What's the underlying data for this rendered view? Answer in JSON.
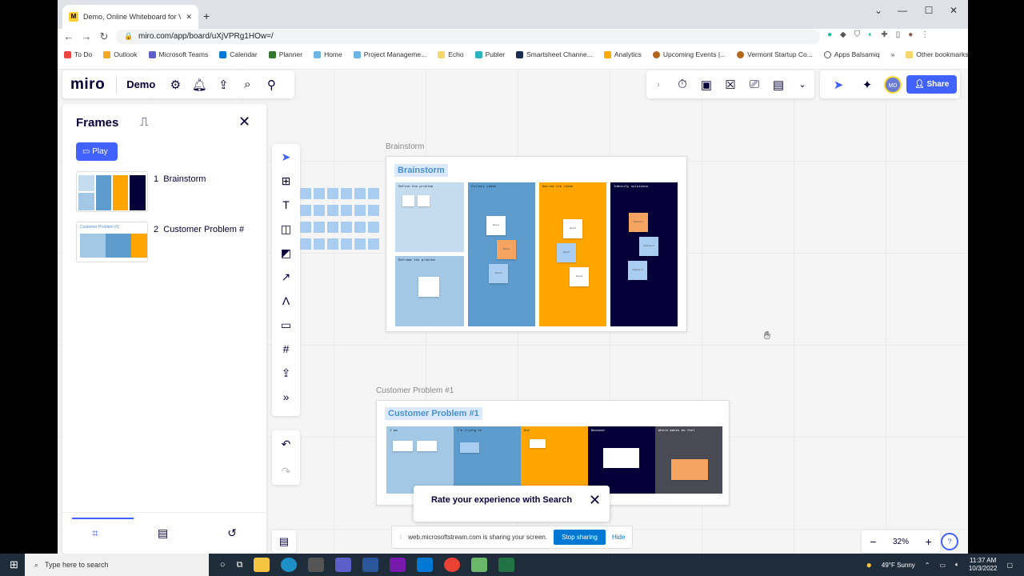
{
  "browser": {
    "tab_title": "Demo, Online Whiteboard for V...",
    "favicon_letter": "M",
    "url": "miro.com/app/board/uXjVPRg1HOw=/",
    "bookmarks": [
      "To Do",
      "Outlook",
      "Microsoft Teams",
      "Calendar",
      "Planner",
      "Home",
      "Project Manageme...",
      "Echo",
      "Publer",
      "Smartsheet Channe...",
      "Analytics",
      "Upcoming Events |...",
      "Vermont Startup Co...",
      "Apps Balsamiq",
      "»",
      "Other bookmarks"
    ]
  },
  "miro": {
    "logo": "miro",
    "board_name": "Demo",
    "share_label": "Share",
    "avatar_initials": "MD",
    "frames_panel": {
      "title": "Frames",
      "play_label": "Play",
      "items": [
        {
          "num": "1",
          "label": "Brainstorm"
        },
        {
          "num": "2",
          "label": "Customer Problem #"
        }
      ]
    },
    "zoom": "32%"
  },
  "board": {
    "brainstorm": {
      "frame_label": "Brainstorm",
      "title": "Brainstorm",
      "columns": [
        "Define the problem",
        "Collect ideas",
        "Narrow the ideas",
        "Identify solutions"
      ],
      "sub_column": "Reframe the problem",
      "notes": [
        "Idea 1",
        "Idea 2",
        "Idea 3",
        "Idea 4",
        "Idea 5",
        "Idea 6",
        "Solution 1",
        "Solution 2",
        "Solution 3"
      ]
    },
    "customer": {
      "frame_label": "Customer Problem #1",
      "title": "Customer Problem #1",
      "columns": [
        "I am",
        "I'm trying to",
        "But",
        "Because",
        "Which makes me feel"
      ]
    }
  },
  "rate_popup": {
    "title": "Rate your experience with Search"
  },
  "sharing_bar": {
    "text": "web.microsoftstream.com is sharing your screen.",
    "stop_label": "Stop sharing",
    "hide_label": "Hide"
  },
  "taskbar": {
    "search_placeholder": "Type here to search",
    "weather": "49°F  Sunny",
    "time": "11:37 AM",
    "date": "10/3/2022"
  }
}
